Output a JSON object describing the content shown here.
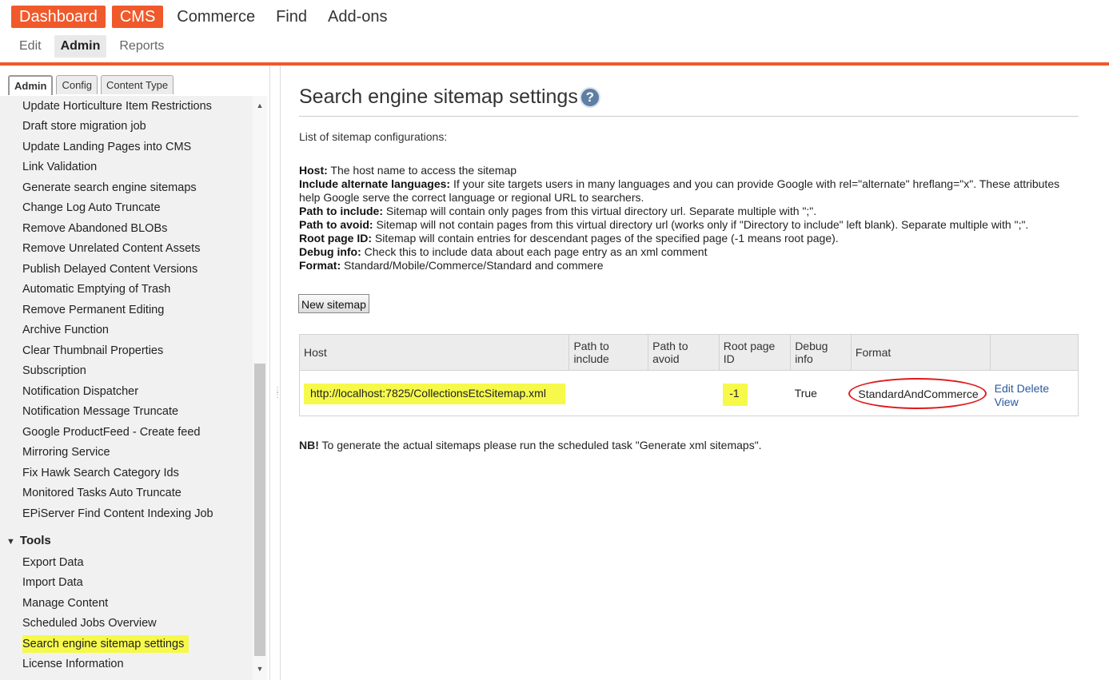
{
  "topnav": {
    "products": [
      "Dashboard",
      "CMS",
      "Commerce",
      "Find",
      "Add-ons"
    ],
    "subnav": [
      "Edit",
      "Admin",
      "Reports"
    ]
  },
  "sidebar": {
    "tabs": [
      "Admin",
      "Config",
      "Content Type"
    ],
    "scheduled_jobs": [
      "Update Horticulture Item Restrictions",
      "Draft store migration job",
      "Update Landing Pages into CMS",
      "Link Validation",
      "Generate search engine sitemaps",
      "Change Log Auto Truncate",
      "Remove Abandoned BLOBs",
      "Remove Unrelated Content Assets",
      "Publish Delayed Content Versions",
      "Automatic Emptying of Trash",
      "Remove Permanent Editing",
      "Archive Function",
      "Clear Thumbnail Properties",
      "Subscription",
      "Notification Dispatcher",
      "Notification Message Truncate",
      "Google ProductFeed - Create feed",
      "Mirroring Service",
      "Fix Hawk Search Category Ids",
      "Monitored Tasks Auto Truncate",
      "EPiServer Find Content Indexing Job"
    ],
    "tools_heading": "Tools",
    "tools": [
      "Export Data",
      "Import Data",
      "Manage Content",
      "Scheduled Jobs Overview",
      "Search engine sitemap settings",
      "License Information"
    ]
  },
  "main": {
    "title": "Search engine sitemap settings",
    "help_icon": "?",
    "intro": "List of sitemap configurations:",
    "descriptions": [
      {
        "term": "Host:",
        "text": " The host name to access the sitemap"
      },
      {
        "term": "Include alternate languages:",
        "text": " If your site targets users in many languages and you can provide Google with rel=\"alternate\" hreflang=\"x\". These attributes help Google serve the correct language or regional URL to searchers."
      },
      {
        "term": "Path to include:",
        "text": " Sitemap will contain only pages from this virtual directory url. Separate multiple with \";\"."
      },
      {
        "term": "Path to avoid:",
        "text": " Sitemap will not contain pages from this virtual directory url (works only if \"Directory to include\" left blank). Separate multiple with \";\"."
      },
      {
        "term": "Root page ID:",
        "text": " Sitemap will contain entries for descendant pages of the specified page (-1 means root page)."
      },
      {
        "term": "Debug info:",
        "text": " Check this to include data about each page entry as an xml comment"
      },
      {
        "term": "Format:",
        "text": " Standard/Mobile/Commerce/Standard and commere"
      }
    ],
    "new_button": "New sitemap",
    "table": {
      "headers": [
        "Host",
        "Path to include",
        "Path to avoid",
        "Root page ID",
        "Debug info",
        "Format",
        ""
      ],
      "row": {
        "host": "http://localhost:7825/CollectionsEtcSitemap.xml",
        "path_include": "",
        "path_avoid": "",
        "root_page_id": "-1",
        "debug_info": "True",
        "format": "StandardAndCommerce",
        "edit": "Edit",
        "delete": "Delete",
        "view": "View"
      }
    },
    "nb_label": "NB!",
    "nb_text": " To generate the actual sitemaps please run the scheduled task \"Generate xml sitemaps\"."
  },
  "colors": {
    "accent": "#f0592b",
    "highlight": "#f6f94a",
    "annotation_red": "#e0191b",
    "link": "#2a5a9c"
  }
}
